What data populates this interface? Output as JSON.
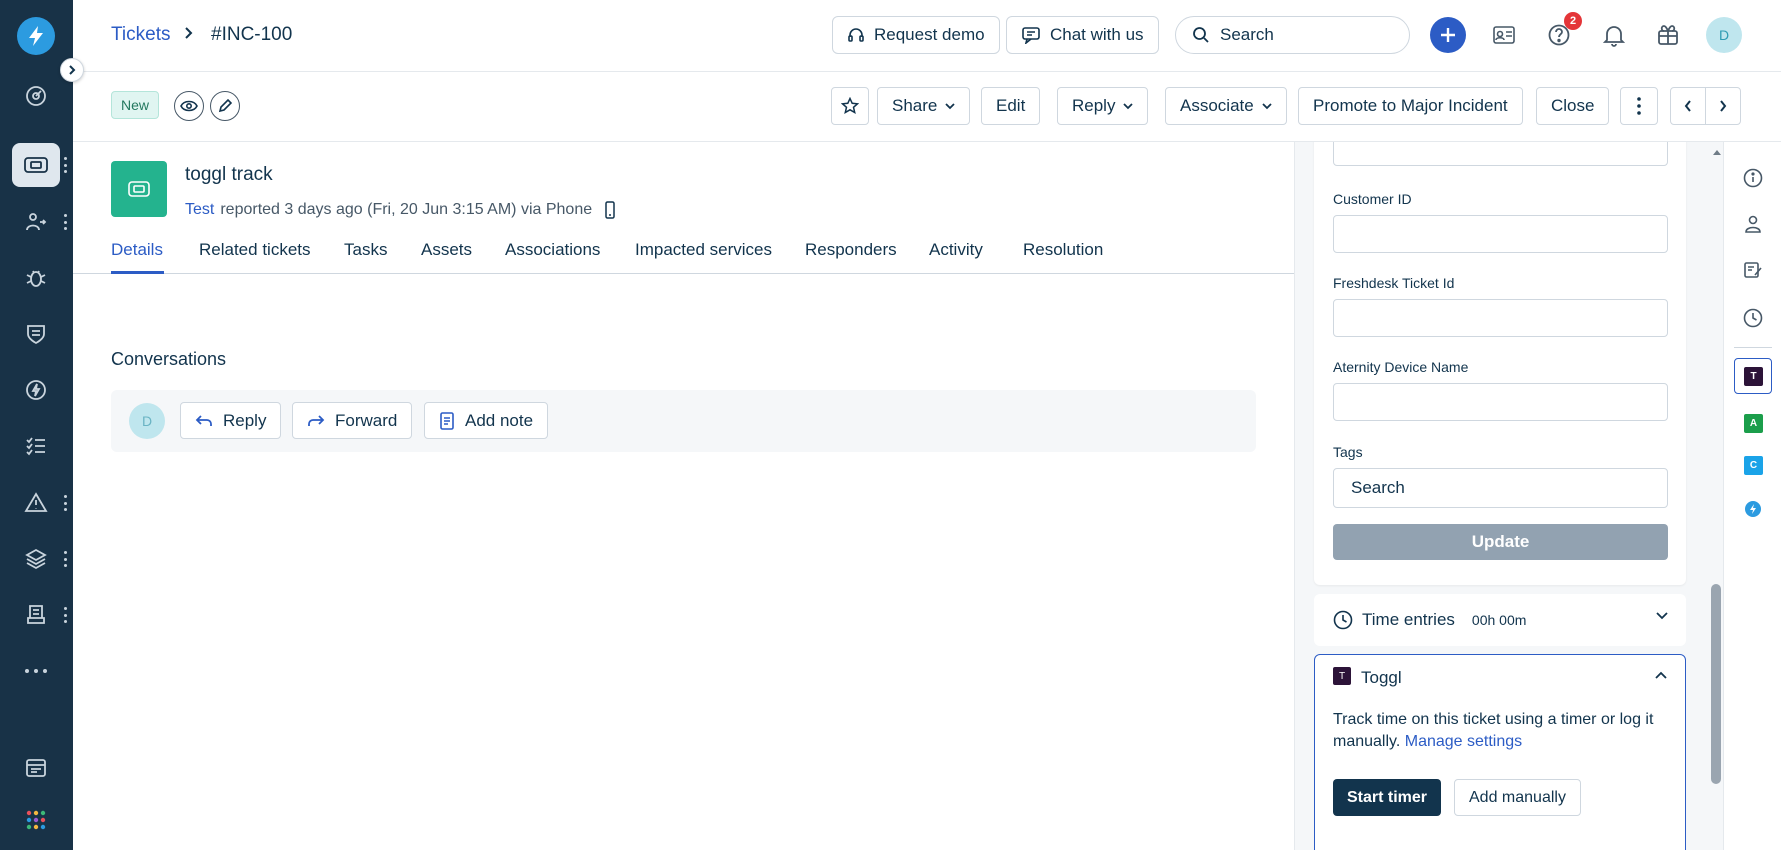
{
  "breadcrumb": {
    "parent": "Tickets",
    "current": "#INC-100"
  },
  "topbar": {
    "request_demo": "Request demo",
    "chat_with_us": "Chat with us",
    "search_placeholder": "Search",
    "help_badge_count": "2",
    "avatar_initial": "D"
  },
  "actionbar": {
    "status": "New",
    "share": "Share",
    "edit": "Edit",
    "reply": "Reply",
    "associate": "Associate",
    "promote": "Promote to Major Incident",
    "close": "Close"
  },
  "ticket": {
    "title": "toggl track",
    "requester": "Test",
    "meta": "reported 3 days ago (Fri, 20 Jun 3:15 AM) via Phone"
  },
  "tabs": [
    "Details",
    "Related tickets",
    "Tasks",
    "Assets",
    "Associations",
    "Impacted services",
    "Responders",
    "Activity",
    "Resolution"
  ],
  "conversations": {
    "title": "Conversations",
    "avatar_initial": "D",
    "reply": "Reply",
    "forward": "Forward",
    "add_note": "Add note"
  },
  "properties": {
    "fields": [
      {
        "label": "Customer ID",
        "value": ""
      },
      {
        "label": "Freshdesk Ticket Id",
        "value": ""
      },
      {
        "label": "Aternity Device Name",
        "value": ""
      }
    ],
    "tags_label": "Tags",
    "tags_placeholder": "Search",
    "update": "Update"
  },
  "time_entries": {
    "label": "Time entries",
    "value": "00h 00m"
  },
  "toggl": {
    "logo_letter": "T",
    "title": "Toggl",
    "description": "Track time on this ticket using a timer or log it manually.",
    "manage_link": "Manage settings",
    "start_timer": "Start timer",
    "add_manually": "Add manually"
  },
  "rail_apps": [
    {
      "letter": "T",
      "color": "#2c1338"
    },
    {
      "letter": "A",
      "color": "#1b9e4b"
    },
    {
      "letter": "C",
      "color": "#1aa3e8"
    }
  ],
  "colors": {
    "nav_bg": "#183247",
    "accent": "#2c5cc5",
    "ticket_icon": "#24b38e",
    "badge_red": "#e43538"
  }
}
